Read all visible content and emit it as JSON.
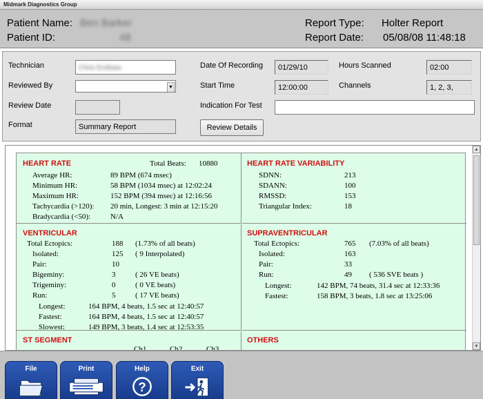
{
  "window": {
    "title": "Midmark Diagnostics Group"
  },
  "header": {
    "patient_name_label": "Patient Name:",
    "patient_name_value": "Ben Barker",
    "patient_id_label": "Patient ID:",
    "patient_id_value": "48",
    "report_type_label": "Report Type:",
    "report_type_value": "Holter Report",
    "report_date_label": "Report Date:",
    "report_date_value": "05/08/08  11:48:18"
  },
  "info": {
    "technician_label": "Technician",
    "technician_value": "Chris Endsaw",
    "reviewed_by_label": "Reviewed By",
    "reviewed_by_value": "",
    "review_date_label": "Review Date",
    "review_date_value": "",
    "format_label": "Format",
    "format_value": "Summary Report",
    "date_of_recording_label": "Date Of Recording",
    "date_of_recording_value": "01/29/10",
    "start_time_label": "Start Time",
    "start_time_value": "12:00:00",
    "indication_label": "Indication For Test",
    "indication_value": "",
    "hours_scanned_label": "Hours Scanned",
    "hours_scanned_value": "02:00",
    "channels_label": "Channels",
    "channels_value": "1,  2,  3,",
    "review_details_button": "Review Details"
  },
  "report": {
    "heart_rate": {
      "title": "HEART RATE",
      "total_beats_label": "Total Beats:",
      "total_beats_value": "10880",
      "rows": [
        {
          "label": "Average HR:",
          "value": "89  BPM (674 msec)"
        },
        {
          "label": "Minimum HR:",
          "value": "58  BPM (1034 msec)   at 12:02:24"
        },
        {
          "label": "Maximum HR:",
          "value": "152 BPM (394 msec)   at 12:16:56"
        },
        {
          "label": "Tachycardia (>120):",
          "value": "20 min,  Longest: 3 min at 12:15:20"
        },
        {
          "label": "Bradycardia (<50):",
          "value": "N/A"
        }
      ]
    },
    "hrv": {
      "title": "HEART  RATE  VARIABILITY",
      "rows": [
        {
          "label": "SDNN:",
          "value": "213"
        },
        {
          "label": "SDANN:",
          "value": "100"
        },
        {
          "label": "RMSSD:",
          "value": "153"
        },
        {
          "label": "Triangular  Index:",
          "value": "18"
        }
      ]
    },
    "ventricular": {
      "title": "VENTRICULAR",
      "rows": [
        {
          "label": "Total  Ectopics:",
          "value": "188",
          "note": "(1.73% of all beats)"
        },
        {
          "label": "Isolated:",
          "value": "125",
          "note": "(    9  Interpolated)"
        },
        {
          "label": "Pair:",
          "value": "10",
          "note": ""
        },
        {
          "label": "Bigeminy:",
          "value": "3",
          "note": "(    26  VE beats)"
        },
        {
          "label": "Trigeminy:",
          "value": "0",
          "note": "(     0  VE beats)"
        },
        {
          "label": "Run:",
          "value": "5",
          "note": "(    17  VE beats)"
        }
      ],
      "runs": [
        {
          "label": "Longest:",
          "value": "164 BPM,    4 beats,  1.5 sec at 12:40:57"
        },
        {
          "label": "Fastest:",
          "value": "164 BPM,    4 beats,  1.5 sec at 12:40:57"
        },
        {
          "label": "Slowest:",
          "value": "149 BPM,    3 beats,  1.4 sec at 12:53:35"
        }
      ]
    },
    "supraventricular": {
      "title": "SUPRAVENTRICULAR",
      "rows": [
        {
          "label": "Total  Ectopics:",
          "value": "765",
          "note": "(7.03% of all beats)"
        },
        {
          "label": "Isolated:",
          "value": "163",
          "note": ""
        },
        {
          "label": "Pair:",
          "value": "33",
          "note": ""
        },
        {
          "label": "Run:",
          "value": "49",
          "note": "(    536  SVE beats )"
        }
      ],
      "runs": [
        {
          "label": "Longest:",
          "value": "142 BPM,    74 beats, 31.4 sec at 12:33:36"
        },
        {
          "label": "Fastest:",
          "value": "158 BPM,     3 beats,  1.8 sec at 13:25:06"
        }
      ]
    },
    "st_segment": {
      "title": "ST  SEGMENT",
      "columns": [
        "Ch1",
        "Ch2",
        "Ch3"
      ]
    },
    "others": {
      "title": "OTHERS"
    }
  },
  "toolbar": {
    "buttons": [
      {
        "label": "File",
        "icon": "folder-icon"
      },
      {
        "label": "Print",
        "icon": "printer-icon"
      },
      {
        "label": "Help",
        "icon": "help-icon"
      },
      {
        "label": "Exit",
        "icon": "exit-icon"
      }
    ]
  }
}
